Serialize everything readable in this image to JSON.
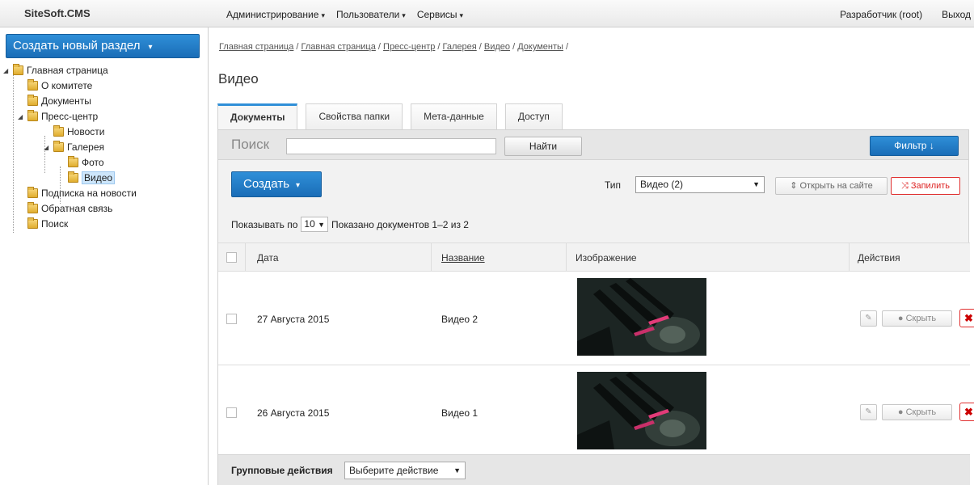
{
  "header": {
    "logo": "SiteSoft.CMS",
    "menu": [
      {
        "label": "Администрирование"
      },
      {
        "label": "Пользователи"
      },
      {
        "label": "Сервисы"
      }
    ],
    "user": "Разработчик (root)",
    "logout": "Выход"
  },
  "sidebar": {
    "create_label": "Создать новый раздел",
    "tree": [
      {
        "label": "Главная страница"
      },
      {
        "label": "О комитете"
      },
      {
        "label": "Документы"
      },
      {
        "label": "Пресс-центр"
      },
      {
        "label": "Новости"
      },
      {
        "label": "Галерея"
      },
      {
        "label": "Фото"
      },
      {
        "label": "Видео"
      },
      {
        "label": "Подписка на новости"
      },
      {
        "label": "Обратная связь"
      },
      {
        "label": "Поиск"
      }
    ]
  },
  "breadcrumb": [
    "Главная страница",
    "Главная страница",
    "Пресс-центр",
    "Галерея",
    "Видео",
    "Документы"
  ],
  "page_title": "Видео",
  "tabs": [
    {
      "label": "Документы",
      "active": true
    },
    {
      "label": "Свойства папки"
    },
    {
      "label": "Мета-данные"
    },
    {
      "label": "Доступ"
    }
  ],
  "search": {
    "label": "Поиск",
    "value": "",
    "find_label": "Найти",
    "filter_label": "Фильтр ↓"
  },
  "toolbar": {
    "create_label": "Создать",
    "type_label": "Тип",
    "type_value": "Видео (2)",
    "open_site_label": "⇕ Открыть на сайте",
    "pin_label": "⤨ Запилить"
  },
  "paging": {
    "show_label": "Показывать по",
    "per_page": "10",
    "shown_text": "Показано документов 1–2 из 2"
  },
  "table": {
    "columns": [
      "Дата",
      "Название",
      "Изображение",
      "Действия"
    ],
    "rows": [
      {
        "date": "27 Августа 2015",
        "title": "Видео 2",
        "hide_label": "Скрыть"
      },
      {
        "date": "26 Августа 2015",
        "title": "Видео 1",
        "hide_label": "Скрыть"
      }
    ]
  },
  "group_actions": {
    "label": "Групповые действия",
    "select_value": "Выберите действие"
  },
  "colors": {
    "accent": "#1a6db7",
    "danger": "#d22222"
  }
}
